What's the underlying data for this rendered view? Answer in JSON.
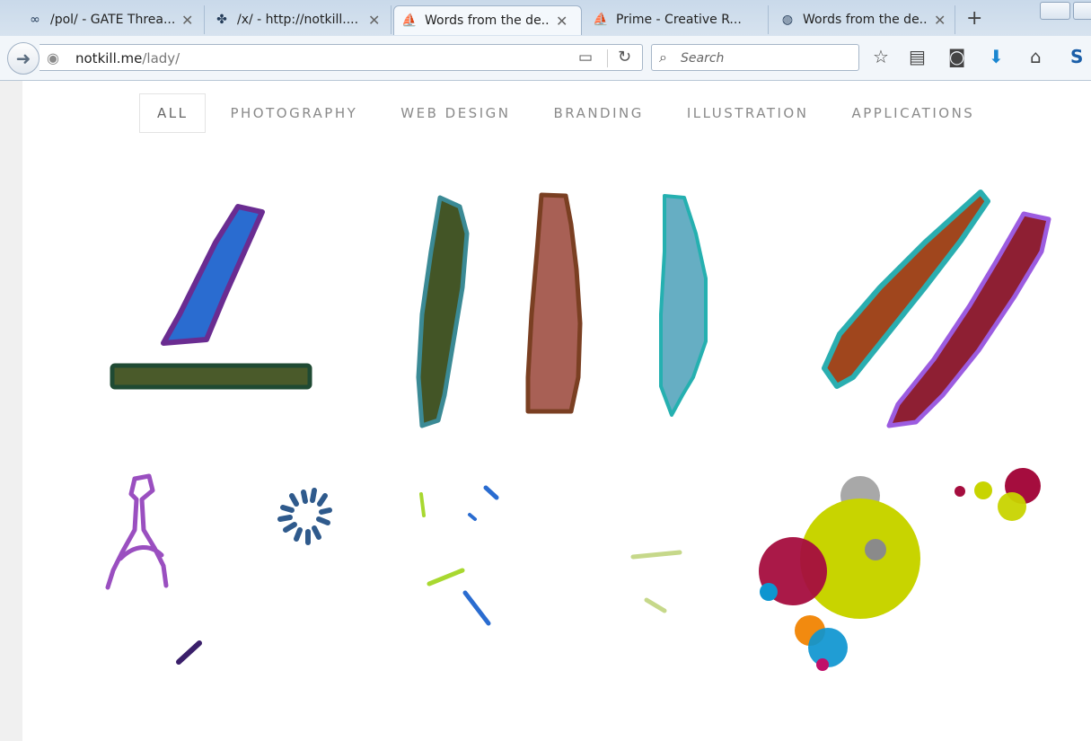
{
  "browser": {
    "tabs": [
      {
        "label": "/pol/ - GATE Threa...",
        "icon": "infinity-icon",
        "close": "✕"
      },
      {
        "label": "/x/ - http://notkill....",
        "icon": "clover-icon",
        "close": "✕"
      },
      {
        "label": "Words from the de...",
        "icon": "ship-icon",
        "close": "✕",
        "active": true
      },
      {
        "label": "Prime - Creative R...",
        "icon": "ship-icon",
        "close": ""
      },
      {
        "label": "Words from the de...",
        "icon": "globe-page-icon",
        "close": "✕"
      }
    ],
    "new_tab": "+",
    "url_host": "notkill.me",
    "url_path": "/lady/",
    "search_placeholder": "Search",
    "toolbar_icons": [
      "star-icon",
      "reading-list-icon",
      "pocket-icon",
      "download-icon",
      "home-icon",
      "sync-icon"
    ]
  },
  "filters": [
    {
      "label": "ALL",
      "active": true
    },
    {
      "label": "PHOTOGRAPHY"
    },
    {
      "label": "WEB DESIGN"
    },
    {
      "label": "BRANDING"
    },
    {
      "label": "ILLUSTRATION"
    },
    {
      "label": "APPLICATIONS"
    }
  ],
  "colors": {
    "blue_fill": "#2a6cd0",
    "purple_outline": "#6a2c91",
    "olive_fill": "#4a5a2a",
    "dark_green_outline": "#1f4a33",
    "teal_outline": "#3b8a95",
    "brown_outline": "#7a3f22",
    "rose_fill": "#a86055",
    "cyan_outline": "#25b0b0",
    "light_blue_fill": "#66aec3",
    "rust_fill": "#a0461d",
    "violet_outline": "#9c5ce0",
    "maroon_fill": "#8e1f33",
    "lime": "#c8d400",
    "crimson": "#a50d3e",
    "orange": "#f28a0f",
    "sky": "#0d95d0",
    "grey": "#8a8a8a"
  }
}
